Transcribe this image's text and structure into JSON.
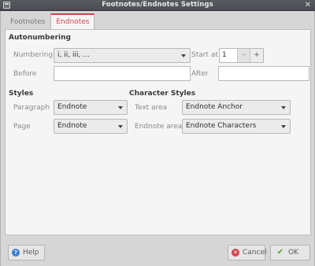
{
  "window": {
    "title": "Footnotes/Endnotes Settings"
  },
  "tabs": [
    {
      "label": "Footnotes",
      "active": false
    },
    {
      "label": "Endnotes",
      "active": true
    }
  ],
  "autonumbering": {
    "title": "Autonumbering",
    "numbering_label": "Numbering",
    "numbering_value": "i, ii, iii, ...",
    "start_at_label": "Start at",
    "start_at_value": "1",
    "before_label": "Before",
    "before_value": "",
    "after_label": "After",
    "after_value": ""
  },
  "styles": {
    "title": "Styles",
    "paragraph_label": "Paragraph",
    "paragraph_value": "Endnote",
    "page_label": "Page",
    "page_value": "Endnote"
  },
  "character_styles": {
    "title": "Character Styles",
    "text_area_label": "Text area",
    "text_area_value": "Endnote Anchor",
    "endnote_area_label": "Endnote area",
    "endnote_area_value": "Endnote Characters"
  },
  "buttons": {
    "help": "Help",
    "cancel": "Cancel",
    "ok": "OK"
  },
  "icons": {
    "help": "help-icon",
    "cancel": "cancel-icon",
    "ok": "checkmark-icon"
  },
  "colors": {
    "accent": "#d0454c",
    "titlebar": "#52565b"
  }
}
